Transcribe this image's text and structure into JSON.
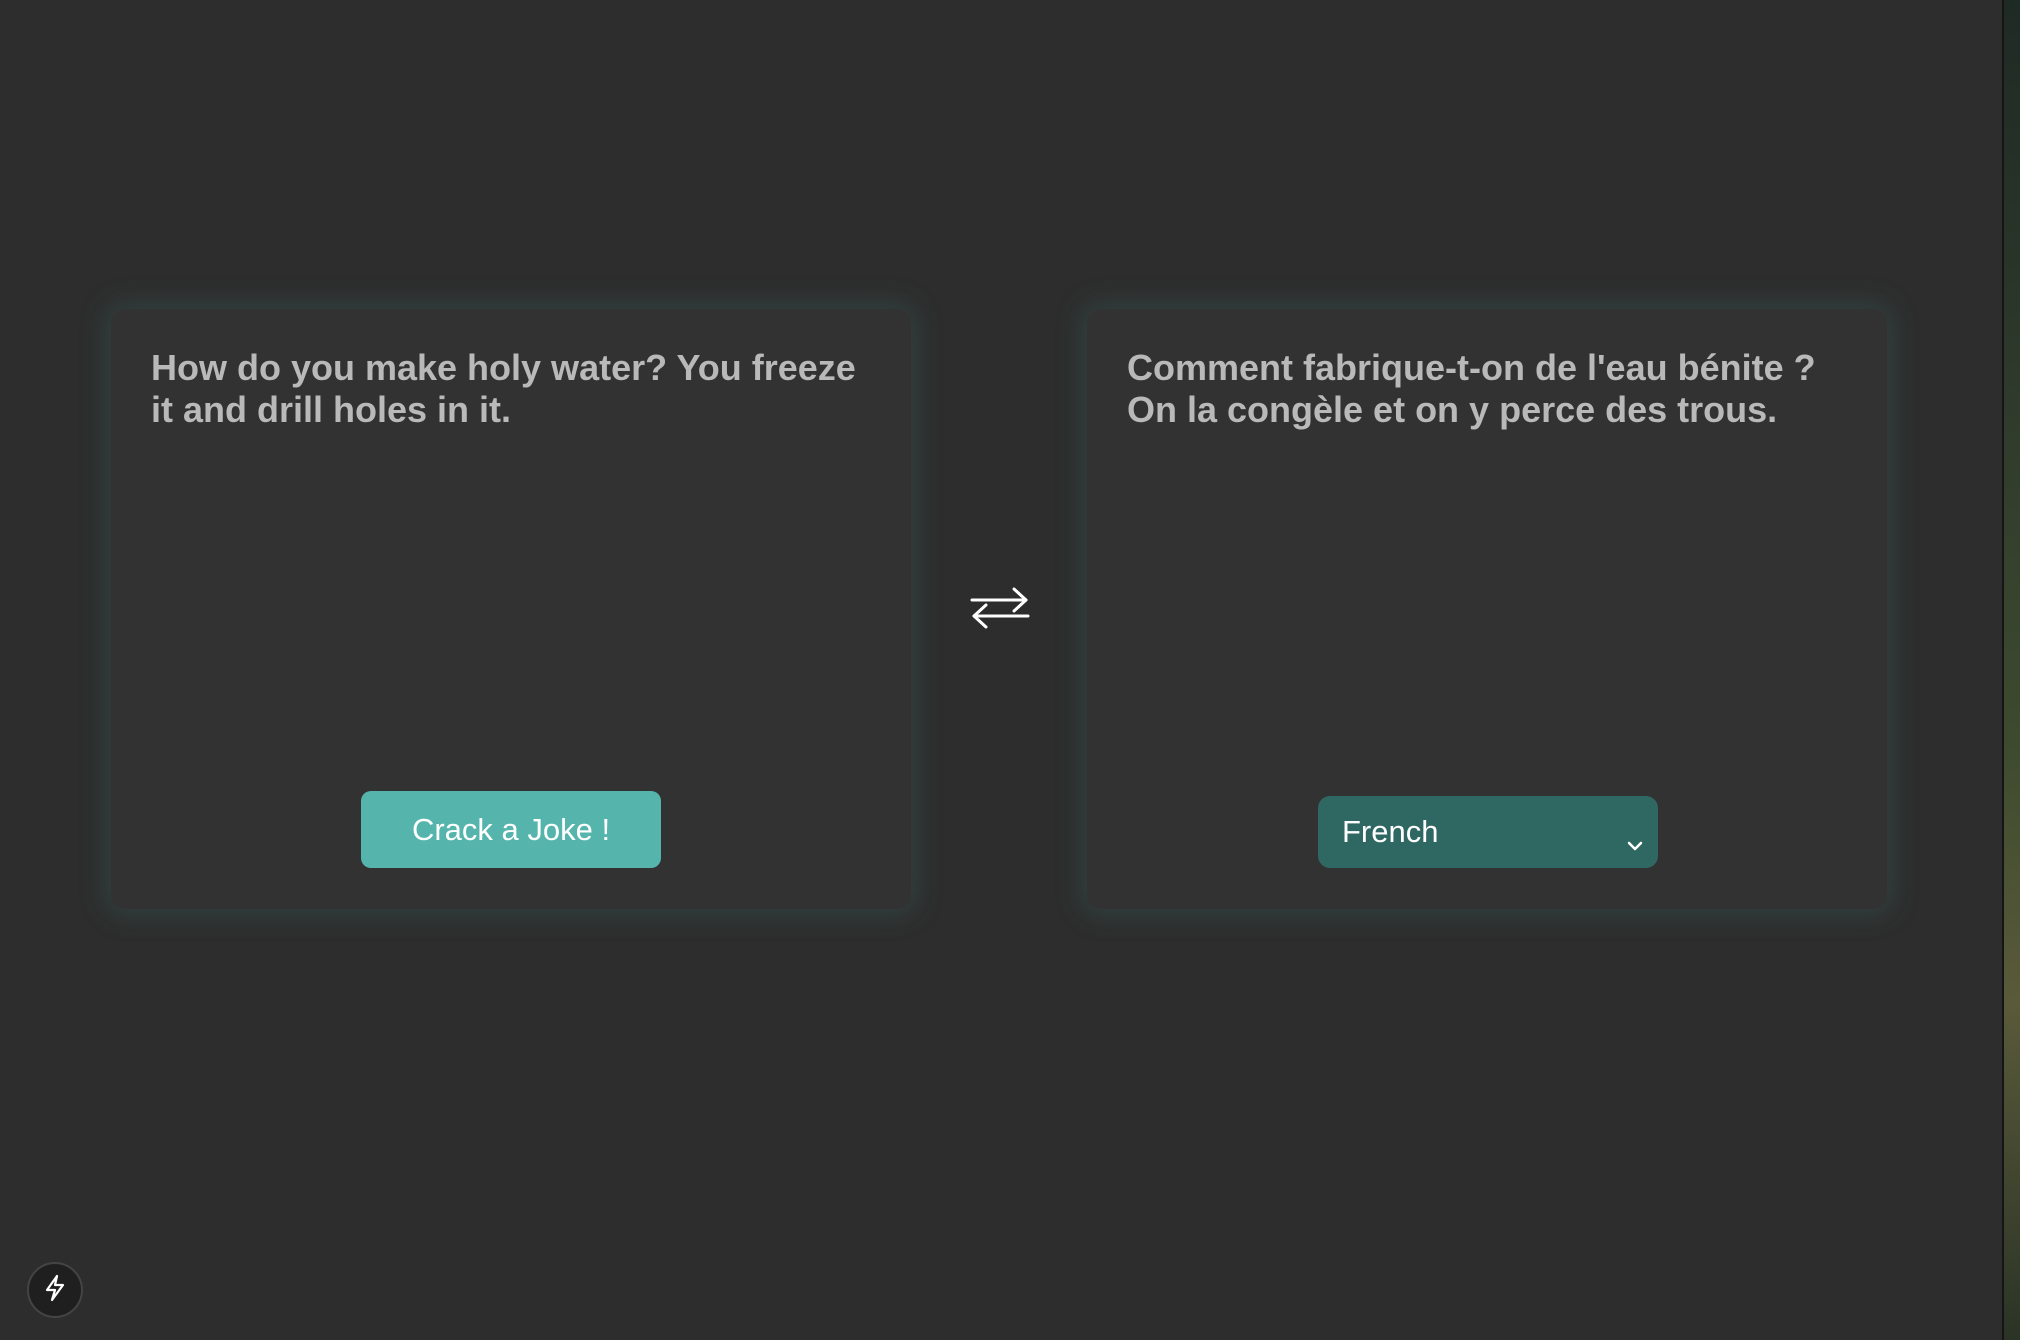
{
  "joke": {
    "original_text": "How do you make holy water? You freeze it and drill holes in it.",
    "translated_text": "Comment fabrique-t-on de l'eau bénite ? On la congèle et on y perce des trous."
  },
  "actions": {
    "crack_joke_label": "Crack a Joke !"
  },
  "language_select": {
    "selected": "French"
  },
  "icons": {
    "swap": "swap-arrows-icon",
    "chevron": "chevron-down-icon",
    "bolt": "lightning-bolt-icon"
  },
  "colors": {
    "background": "#2d2d2d",
    "card": "#323232",
    "text": "#b9b9b9",
    "button": "#55b5ad",
    "select": "#2f6863",
    "glow": "#3c786e"
  }
}
